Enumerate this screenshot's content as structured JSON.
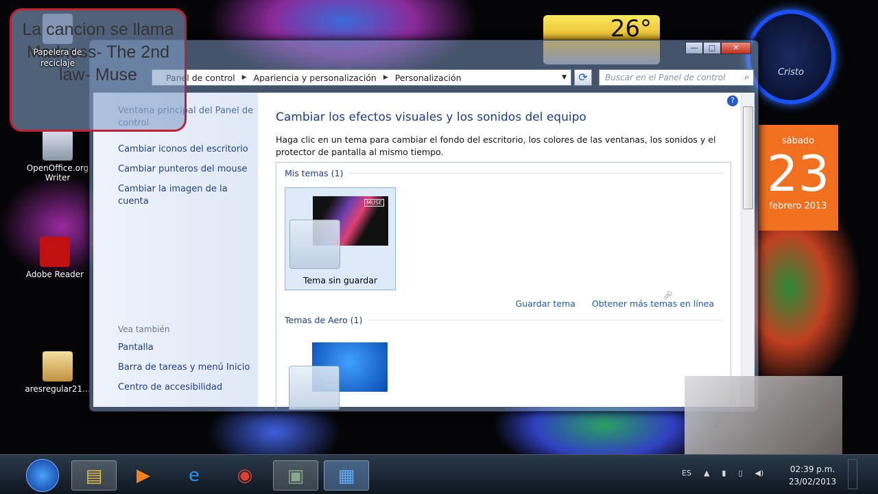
{
  "caption": "La cancion se llama Madness- The 2nd law- Muse",
  "desktop_icons": [
    {
      "label": "Papelera de reciclaje"
    },
    {
      "label": "OpenOffice.org Writer"
    },
    {
      "label": "Adobe Reader"
    },
    {
      "label": "aresregular21..."
    }
  ],
  "gadgets": {
    "weather_temp": "26°",
    "clock_label": "Cristo",
    "calendar": {
      "weekday": "sábado",
      "day": "23",
      "month_year": "febrero 2013"
    }
  },
  "window": {
    "controls": {
      "minimize": "—",
      "maximize": "□",
      "close": "✕"
    },
    "breadcrumb": [
      "Panel de control",
      "Apariencia y personalización",
      "Personalización"
    ],
    "search_placeholder": "Buscar en el Panel de control",
    "left_links": [
      "Ventana principal del Panel de control",
      "Cambiar iconos del escritorio",
      "Cambiar punteros del mouse",
      "Cambiar la imagen de la cuenta"
    ],
    "see_also": {
      "heading": "Vea también",
      "links": [
        "Pantalla",
        "Barra de tareas y menú Inicio",
        "Centro de accesibilidad"
      ]
    },
    "title": "Cambiar los efectos visuales y los sonidos del equipo",
    "description": "Haga clic en un tema para cambiar el fondo del escritorio, los colores de las ventanas, los sonidos y el protector de pantalla al mismo tiempo.",
    "groups": {
      "my_themes": "Mis temas (1)",
      "aero_themes": "Temas de Aero (1)"
    },
    "unsaved_theme": "Tema sin guardar",
    "muse_text": "MUSE",
    "save_theme": "Guardar tema",
    "more_themes": "Obtener más temas en línea"
  },
  "taskbar": {
    "lang": "ES",
    "time": "02:39 p.m.",
    "date": "23/02/2013"
  }
}
